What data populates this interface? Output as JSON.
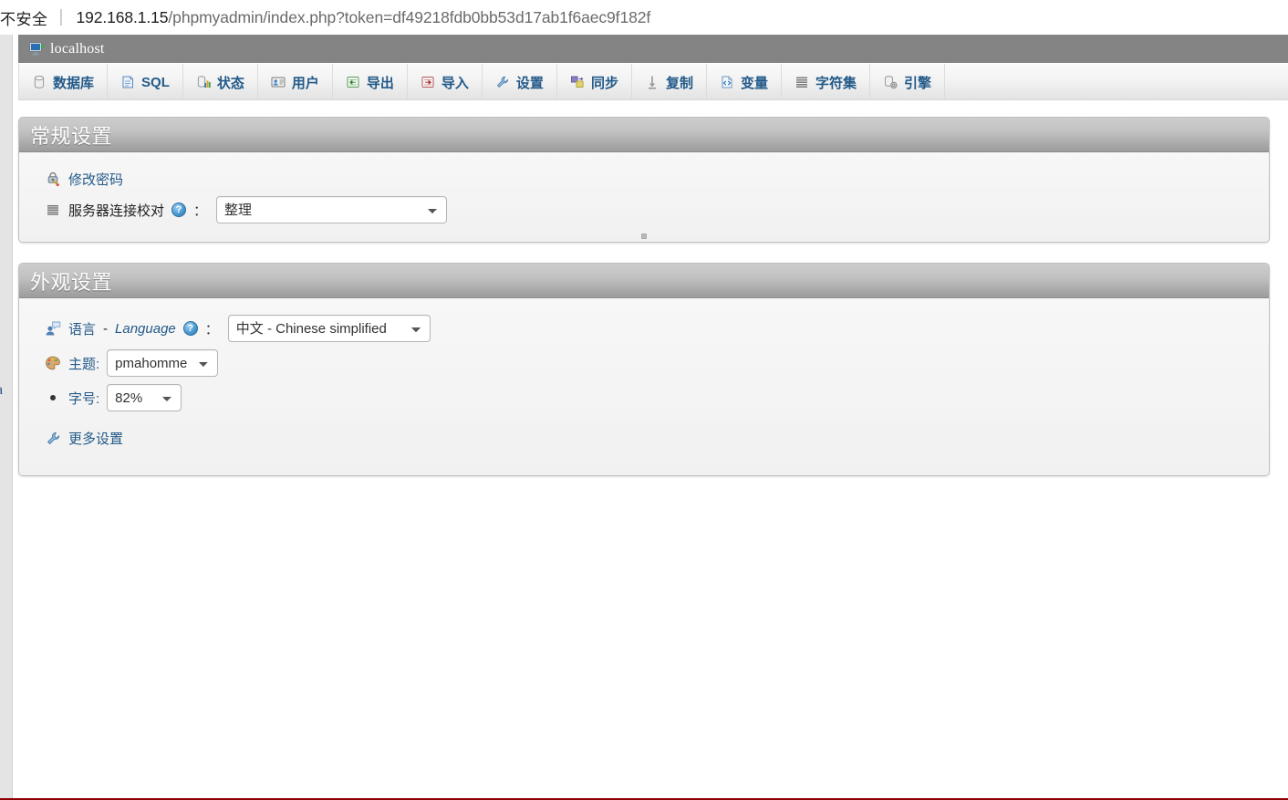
{
  "browser": {
    "security_label": "不安全",
    "separator": "|",
    "url_host": "192.168.1.15",
    "url_path": "/phpmyadmin/index.php?token=df49218fdb0bb53d17ab1f6aec9f182f"
  },
  "server": {
    "icon": "server-monitor-icon",
    "title": "localhost"
  },
  "tabs": [
    {
      "label": "数据库",
      "icon": "database-icon"
    },
    {
      "label": "SQL",
      "icon": "sql-document-icon"
    },
    {
      "label": "状态",
      "icon": "status-chart-icon"
    },
    {
      "label": "用户",
      "icon": "users-card-icon"
    },
    {
      "label": "导出",
      "icon": "export-icon"
    },
    {
      "label": "导入",
      "icon": "import-icon"
    },
    {
      "label": "设置",
      "icon": "wrench-icon"
    },
    {
      "label": "同步",
      "icon": "synchronize-icon"
    },
    {
      "label": "复制",
      "icon": "replication-icon"
    },
    {
      "label": "变量",
      "icon": "variables-icon"
    },
    {
      "label": "字符集",
      "icon": "charset-icon"
    },
    {
      "label": "引擎",
      "icon": "engines-icon"
    }
  ],
  "general_settings": {
    "title": "常规设置",
    "change_password": {
      "label": "修改密码",
      "icon": "lock-key-icon"
    },
    "connection_collation": {
      "label": "服务器连接校对",
      "icon": "collation-lines-icon",
      "help_icon": "help-question-icon",
      "help_glyph": "?",
      "colon": "：",
      "value": "整理",
      "options": [
        "整理"
      ]
    }
  },
  "appearance_settings": {
    "title": "外观设置",
    "language": {
      "label_cn": "语言",
      "dash": "-",
      "label_en": "Language",
      "icon": "language-person-icon",
      "help_icon": "help-question-icon",
      "help_glyph": "?",
      "colon": "：",
      "value": "中文 - Chinese simplified",
      "options": [
        "中文 - Chinese simplified"
      ]
    },
    "theme": {
      "label": "主题:",
      "icon": "palette-icon",
      "value": "pmahomme",
      "options": [
        "pmahomme"
      ]
    },
    "font_size": {
      "label": "字号:",
      "icon": "bullet-dot-icon",
      "value": "82%",
      "options": [
        "82%"
      ]
    },
    "more_settings": {
      "label": "更多设置",
      "icon": "wrench-icon"
    }
  },
  "sidebar": {
    "cut_text": "a"
  },
  "colors": {
    "header_gray": "#848484",
    "panel_header_gray": "#9b9b9b",
    "link_blue": "#235a89",
    "bottom_rule_red": "#8c0000"
  }
}
